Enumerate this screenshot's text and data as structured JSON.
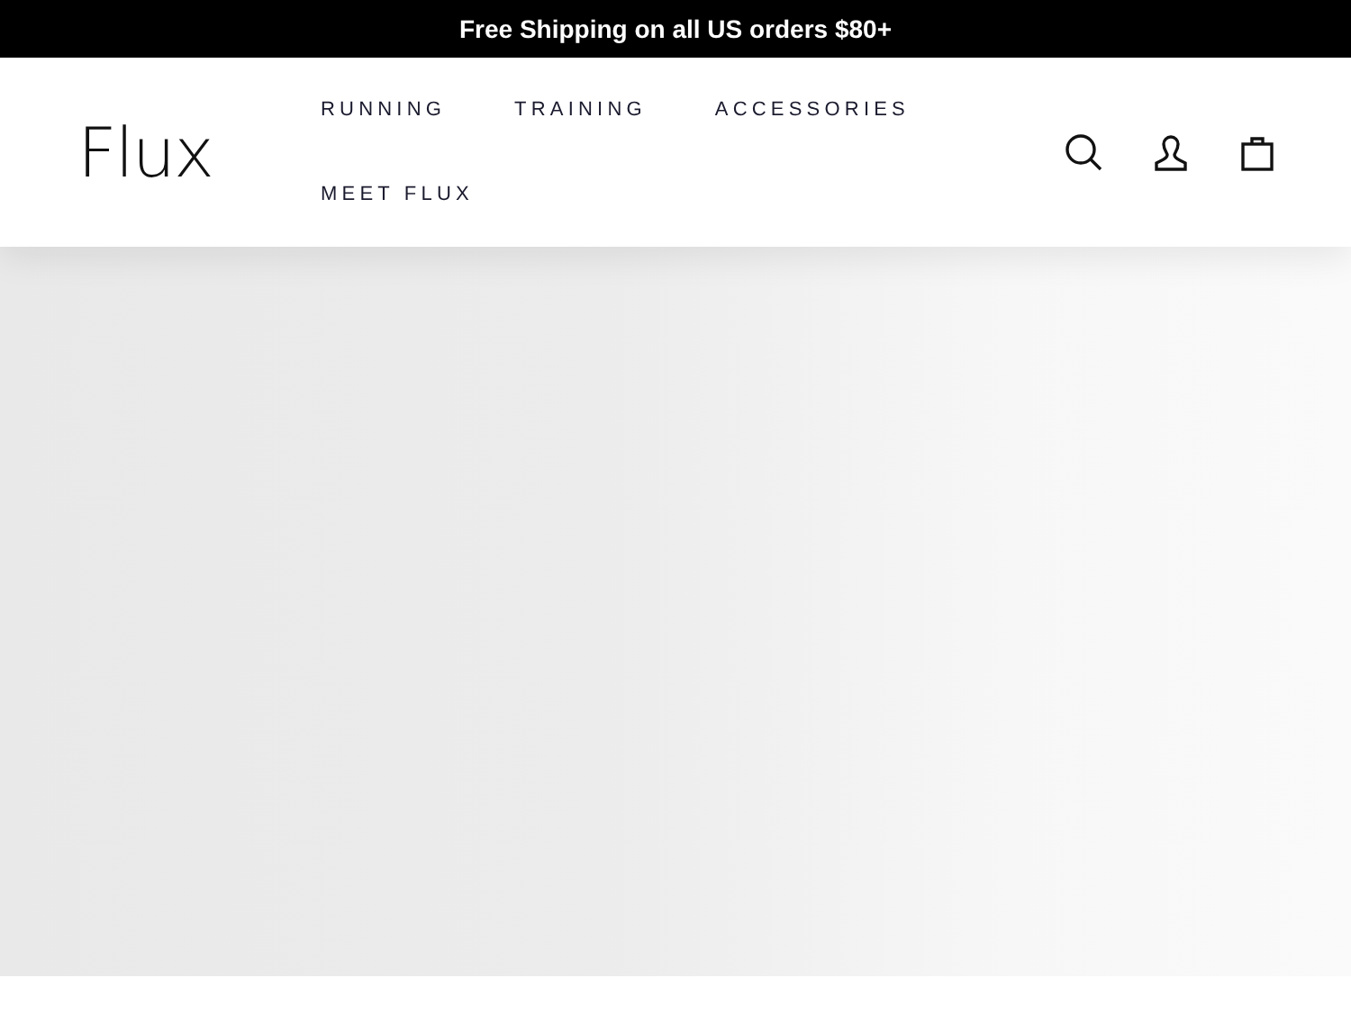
{
  "announcement": "Free Shipping on all US orders $80+",
  "logo": "Flux",
  "nav": [
    "RUNNING",
    "TRAINING",
    "ACCESSORIES",
    "MEET FLUX"
  ]
}
